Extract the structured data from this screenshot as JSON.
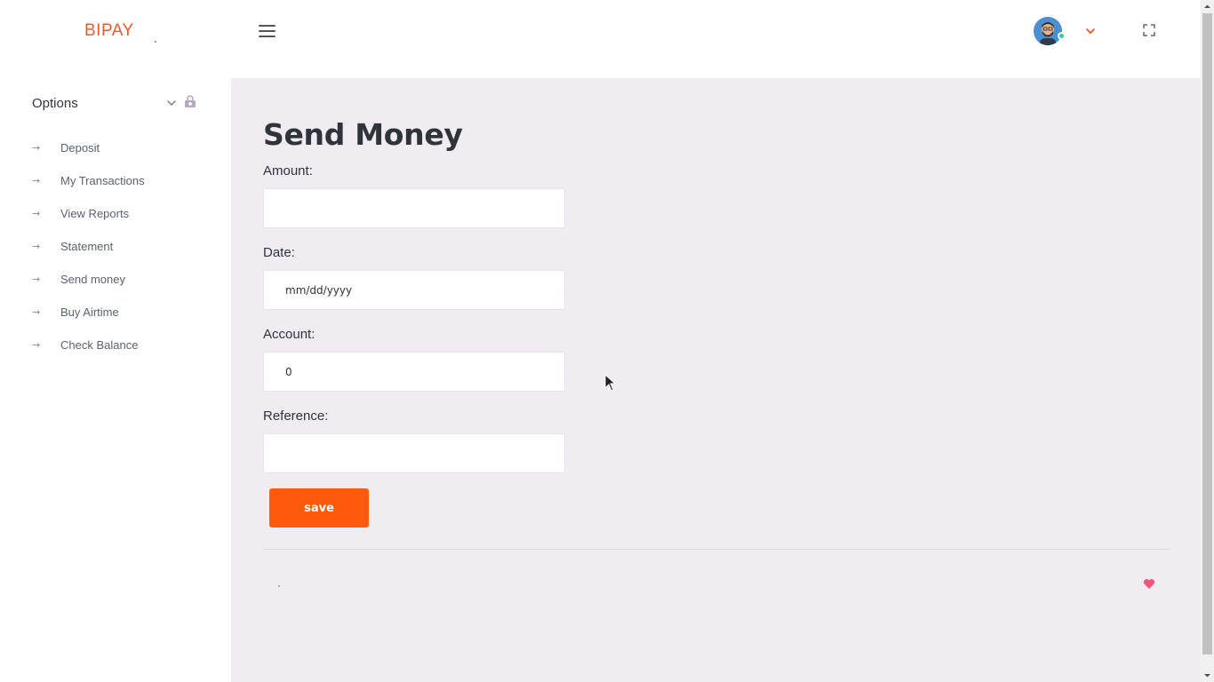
{
  "app": {
    "logo_text": "BIPAY"
  },
  "colors": {
    "brand": "#f05a28",
    "accent_button": "#ff5a0a",
    "content_bg": "#f0ecf1",
    "status_online": "#2ecc9a",
    "heart": "#f0557a"
  },
  "header": {
    "menu_icon": "hamburger-icon",
    "avatar_icon": "user-avatar",
    "dropdown_icon": "chevron-down-icon",
    "fullscreen_icon": "fullscreen-icon"
  },
  "sidebar": {
    "section_title": "Options",
    "section_icons": [
      "chevron-down-icon",
      "lock-icon"
    ],
    "items": [
      {
        "label": "Deposit",
        "icon": "arrow-right-icon"
      },
      {
        "label": "My Transactions",
        "icon": "arrow-right-icon"
      },
      {
        "label": "View Reports",
        "icon": "arrow-right-icon"
      },
      {
        "label": "Statement",
        "icon": "arrow-right-icon"
      },
      {
        "label": "Send money",
        "icon": "arrow-right-icon"
      },
      {
        "label": "Buy Airtime",
        "icon": "arrow-right-icon"
      },
      {
        "label": "Check Balance",
        "icon": "arrow-right-icon"
      }
    ]
  },
  "main": {
    "title": "Send Money",
    "form": {
      "amount": {
        "label": "Amount:",
        "value": ""
      },
      "date": {
        "label": "Date:",
        "placeholder": "mm/dd/yyyy",
        "value": ""
      },
      "account": {
        "label": "Account:",
        "value": "0"
      },
      "reference": {
        "label": "Reference:",
        "value": ""
      },
      "save_label": "save"
    },
    "footer_icon": "heart-icon"
  }
}
